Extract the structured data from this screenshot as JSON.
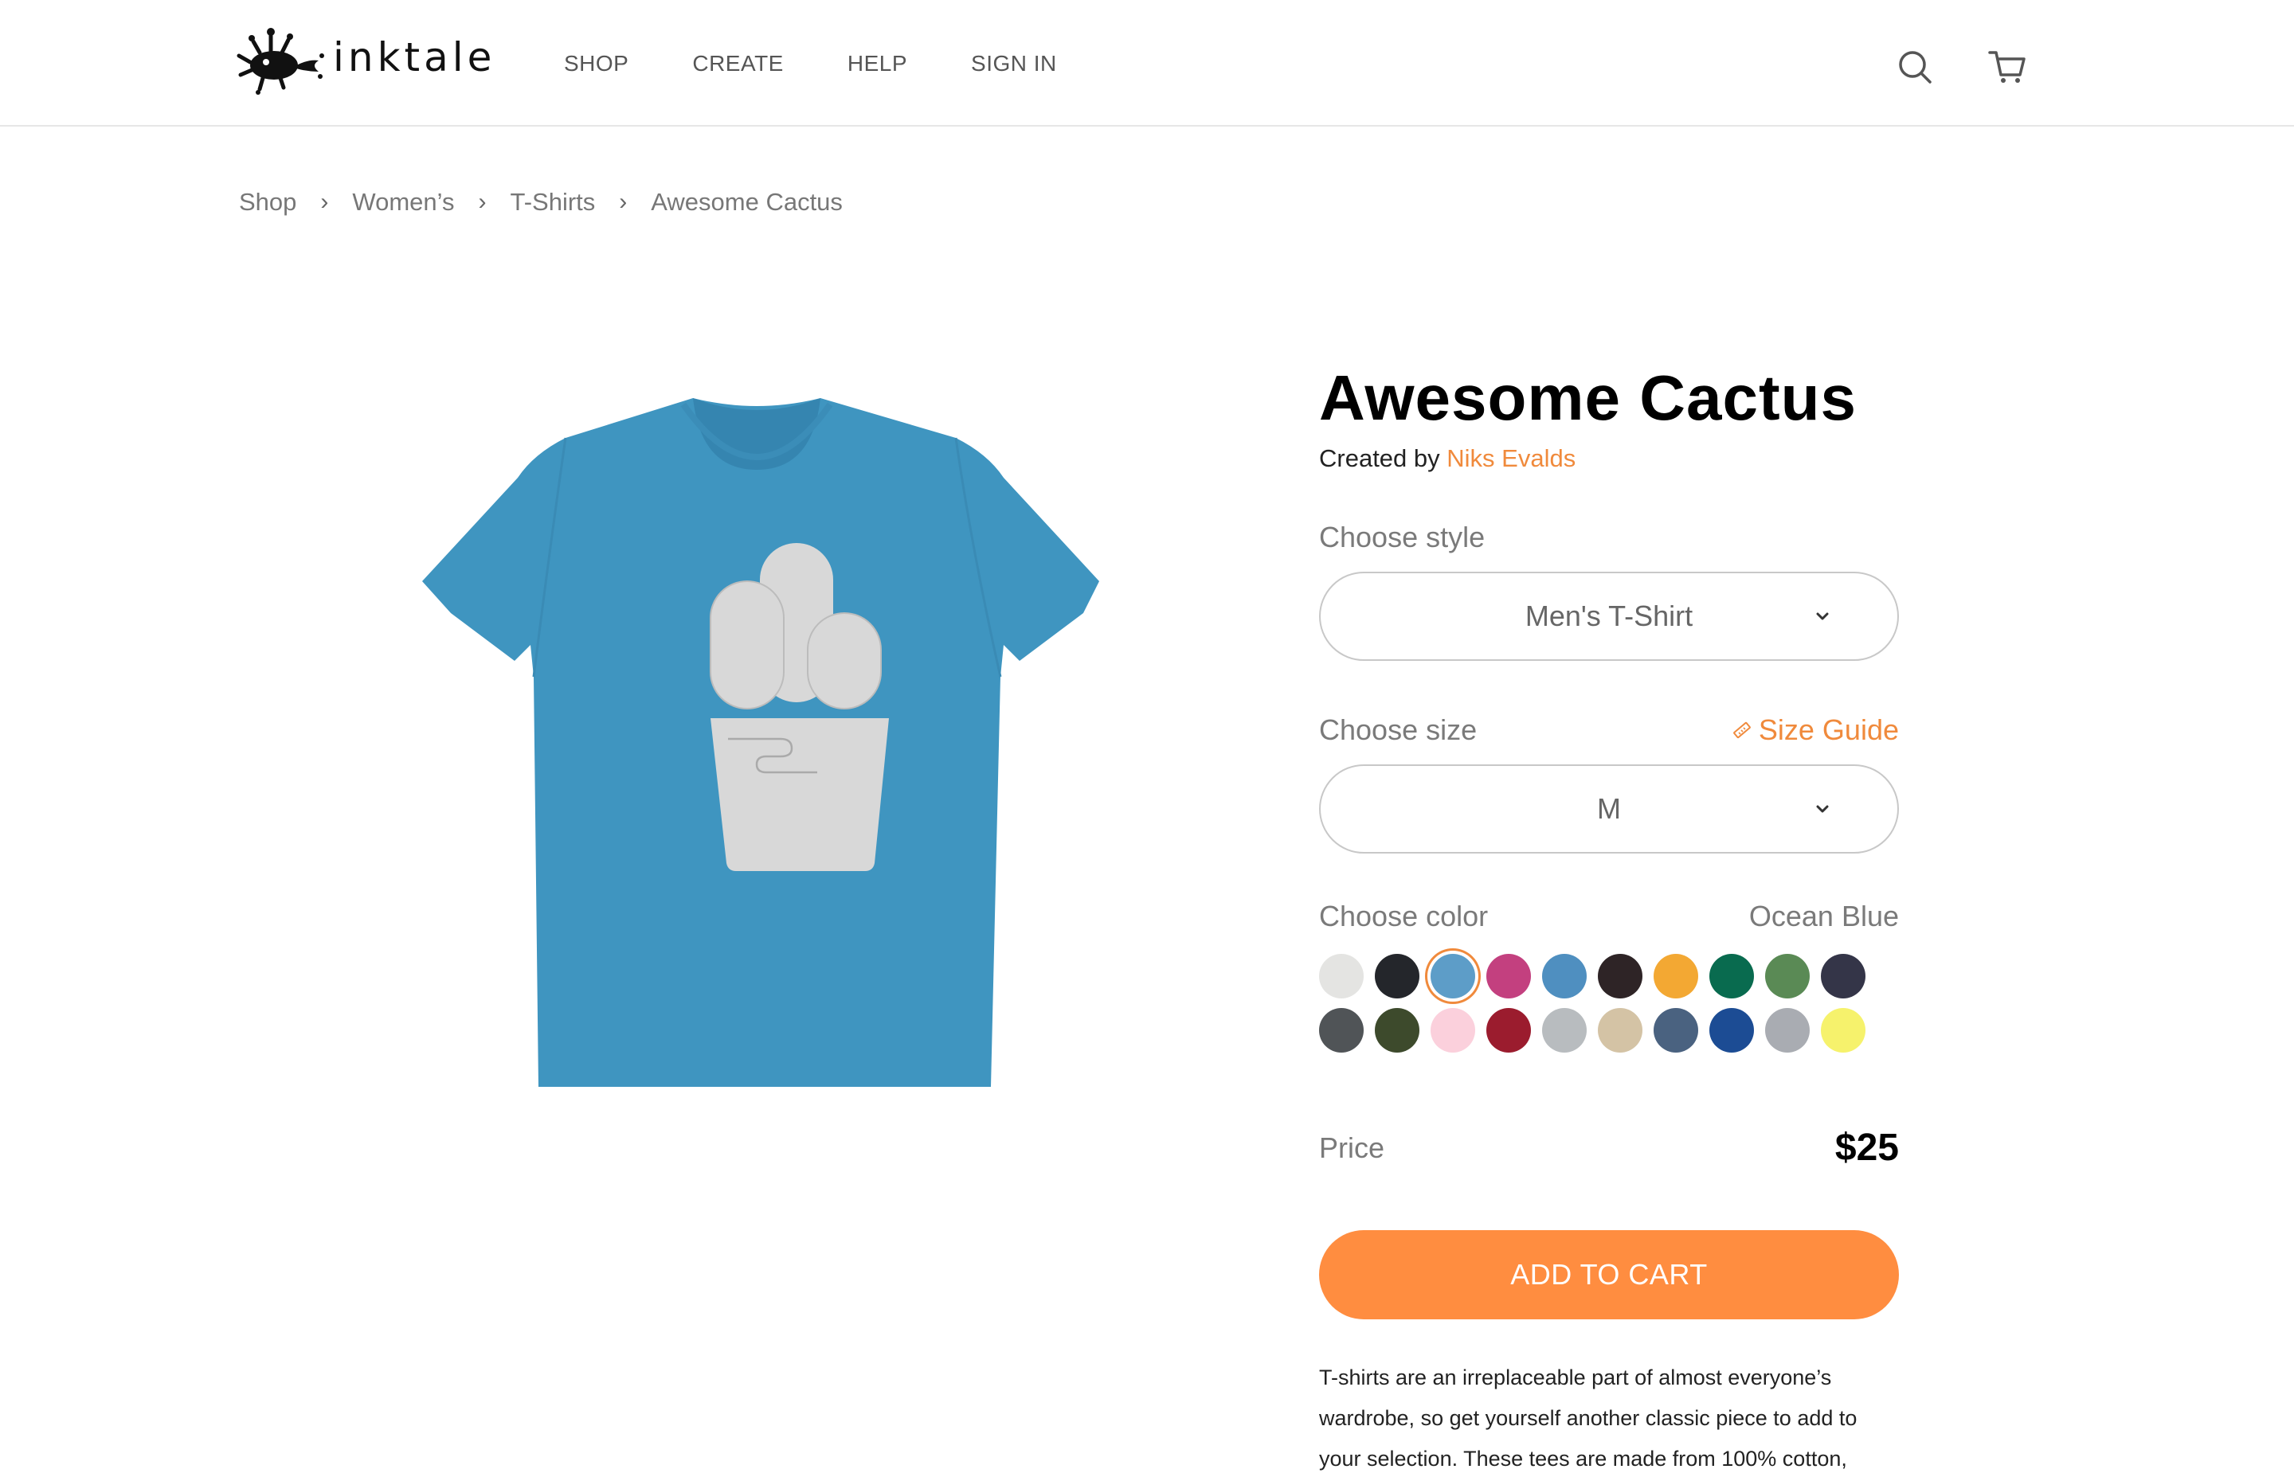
{
  "header": {
    "logo_text": "inktale",
    "nav": [
      {
        "label": "SHOP"
      },
      {
        "label": "CREATE"
      },
      {
        "label": "HELP"
      },
      {
        "label": "SIGN IN"
      }
    ],
    "icons": [
      "search-icon",
      "cart-icon"
    ]
  },
  "breadcrumb": [
    "Shop",
    "Women’s",
    "T-Shirts",
    "Awesome Cactus"
  ],
  "breadcrumb_separator": "›",
  "product": {
    "title": "Awesome Cactus",
    "created_by_label": "Created by",
    "creator": "Niks Evalds",
    "style_label": "Choose style",
    "style_value": "Men's T-Shirt",
    "size_label": "Choose size",
    "size_guide_label": "Size Guide",
    "size_value": "M",
    "color_label": "Choose color",
    "selected_color_name": "Ocean Blue",
    "colors": [
      "#e4e4e2",
      "#24262b",
      "#5d9dc8",
      "#c3407f",
      "#4f8fc0",
      "#2e2426",
      "#f3a833",
      "#096b4f",
      "#5a8a55",
      "#343548",
      "#505457",
      "#3d4a2c",
      "#fbd0dc",
      "#9b1c2e",
      "#b8bcbf",
      "#d4c3a5",
      "#4a6280",
      "#1c4c94",
      "#a9acb2",
      "#f6f26c"
    ],
    "selected_color_index": 2,
    "price_label": "Price",
    "price": "$25",
    "cart_button_label": "ADD TO CART",
    "description": "T-shirts are an irreplaceable part of almost everyone’s wardrobe, so get yourself another classic piece to add to your selection. These tees are made from 100% cotton,"
  },
  "colors": {
    "accent": "#ff8d40",
    "link": "#f08a3c",
    "shirt": "#3f95c0",
    "pot_band": "#e58a4f",
    "cactus": "#d8d8d8"
  }
}
